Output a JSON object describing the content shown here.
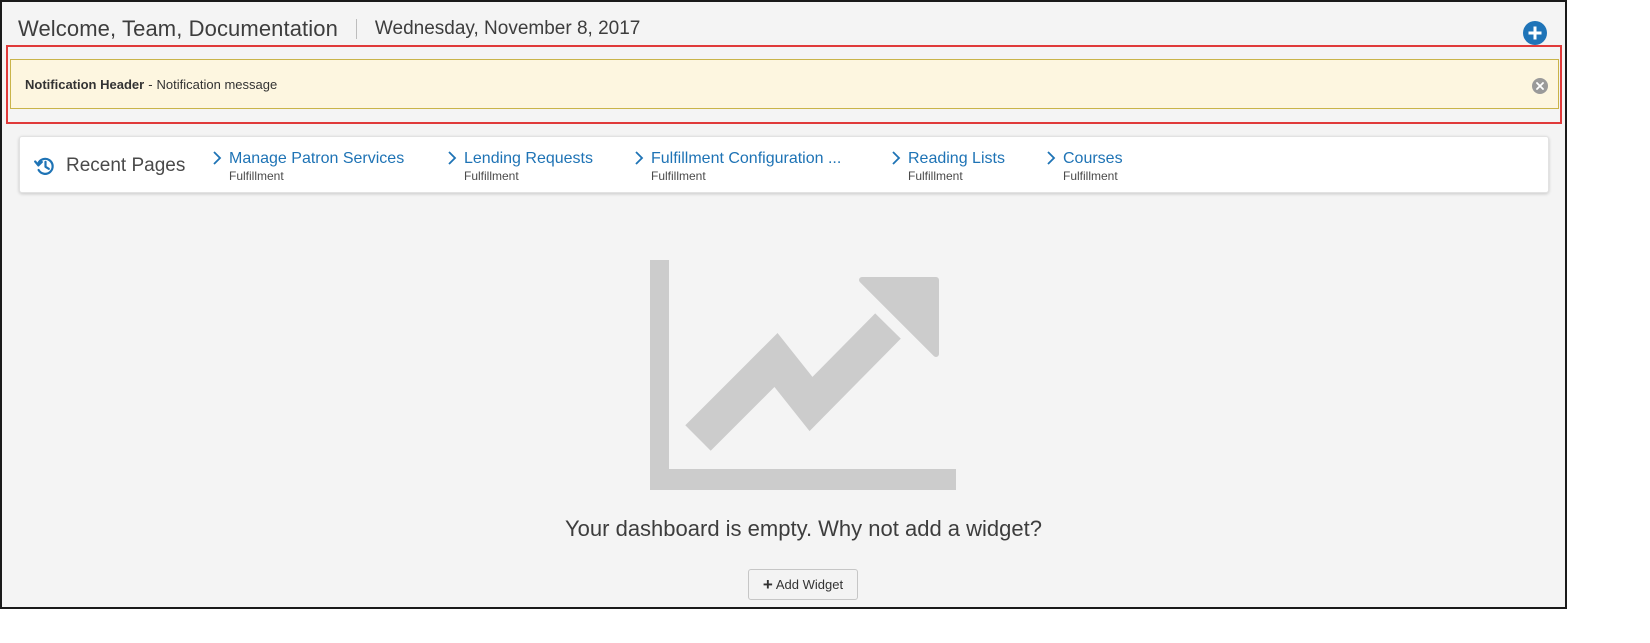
{
  "header": {
    "welcome": "Welcome, Team, Documentation",
    "date": "Wednesday, November 8, 2017"
  },
  "notification": {
    "header": "Notification Header",
    "separator": "-",
    "message": "Notification message"
  },
  "recent_pages": {
    "title": "Recent Pages",
    "items": [
      {
        "label": "Manage Patron Services",
        "category": "Fulfillment"
      },
      {
        "label": "Lending Requests",
        "category": "Fulfillment"
      },
      {
        "label": "Fulfillment Configuration ...",
        "category": "Fulfillment"
      },
      {
        "label": "Reading Lists",
        "category": "Fulfillment"
      },
      {
        "label": "Courses",
        "category": "Fulfillment"
      }
    ]
  },
  "dashboard": {
    "empty_message": "Your dashboard is empty. Why not add a widget?",
    "add_widget_icon": "+",
    "add_widget_label": "Add Widget"
  },
  "icons": {
    "add": "plus-circle-icon",
    "close": "close-circle-icon",
    "history": "history-icon",
    "chevron": "chevron-right-icon",
    "chart": "trend-chart-illustration"
  },
  "colors": {
    "accent": "#1e73b5",
    "notification_bg": "#fdf6e0",
    "highlight_border": "#e03a3a",
    "illustration": "#cccccc"
  }
}
